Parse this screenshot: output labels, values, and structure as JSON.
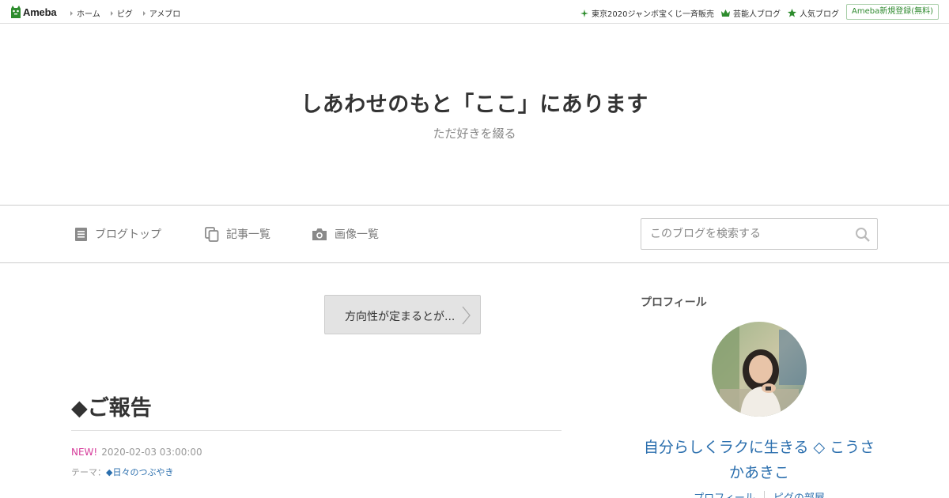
{
  "topbar": {
    "logo_text": "Ameba",
    "links": [
      "ホーム",
      "ピグ",
      "アメブロ"
    ],
    "right_links": [
      "東京2020ジャンボ宝くじ一斉販売",
      "芸能人ブログ",
      "人気ブログ"
    ],
    "register_label": "Ameba新規登録(無料)"
  },
  "header": {
    "title": "しあわせのもと「ここ」にあります",
    "description": "ただ好きを綴る"
  },
  "nav": {
    "items": [
      "ブログトップ",
      "記事一覧",
      "画像一覧"
    ],
    "search_placeholder": "このブログを検索する"
  },
  "main": {
    "prev_label": "方向性が定まるとが...",
    "entry": {
      "title": "◆ご報告",
      "new_label": "NEW!",
      "date": "2020-02-03 03:00:00",
      "theme_prefix": "テーマ：",
      "theme": "◆日々のつぶやき"
    }
  },
  "sidebar": {
    "heading": "プロフィール",
    "name": "自分らしくラクに生きる ◇ こうさかあきこ",
    "links": [
      "プロフィール",
      "ピグの部屋"
    ]
  },
  "colors": {
    "brand_green": "#2d8c2d",
    "link_blue": "#2b6fae",
    "new_pink": "#d63c9b"
  }
}
